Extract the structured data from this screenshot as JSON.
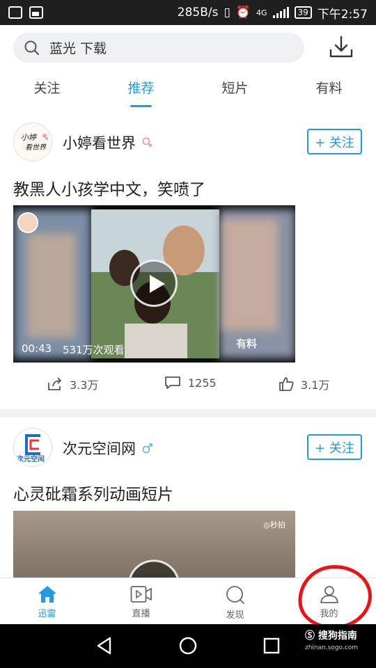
{
  "status_bar": {
    "speed": "285B/s",
    "network": "4G",
    "battery": "39",
    "time": "下午2:57"
  },
  "search": {
    "query": "蓝光 下载",
    "icon": "search-icon"
  },
  "header": {
    "download_icon": "download-icon"
  },
  "tabs": [
    {
      "label": "关注",
      "active": false
    },
    {
      "label": "推荐",
      "active": true
    },
    {
      "label": "短片",
      "active": false
    },
    {
      "label": "有料",
      "active": false
    }
  ],
  "feed": [
    {
      "author": "小婷看世界",
      "avatar_text": "小婷看世界",
      "gender": "female",
      "follow_label": "+ 关注",
      "title": "教黑人小孩学中文，笑喷了",
      "video": {
        "duration": "00:43",
        "views": "531万次观看",
        "watermark": "有料"
      },
      "actions": {
        "share": "3.3万",
        "comments": "1255",
        "likes": "3.1万"
      }
    },
    {
      "author": "次元空间网",
      "avatar_text": "次元空间",
      "gender": "male",
      "follow_label": "+ 关注",
      "title": "心灵砒霜系列动画短片",
      "video": {
        "watermark": "◎秒拍"
      }
    }
  ],
  "bottom_nav": [
    {
      "label": "迅雷",
      "icon": "home-icon",
      "active": true
    },
    {
      "label": "直播",
      "icon": "live-video-icon",
      "active": false
    },
    {
      "label": "发现",
      "icon": "discover-search-icon",
      "active": false
    },
    {
      "label": "我的",
      "icon": "profile-icon",
      "active": false
    }
  ],
  "watermark": {
    "brand": "搜狗指南",
    "url": "zhinan.sogo.com"
  },
  "colors": {
    "accent": "#1e9be8",
    "annotation": "#e11111",
    "status_bar": "#1f1f1f"
  }
}
